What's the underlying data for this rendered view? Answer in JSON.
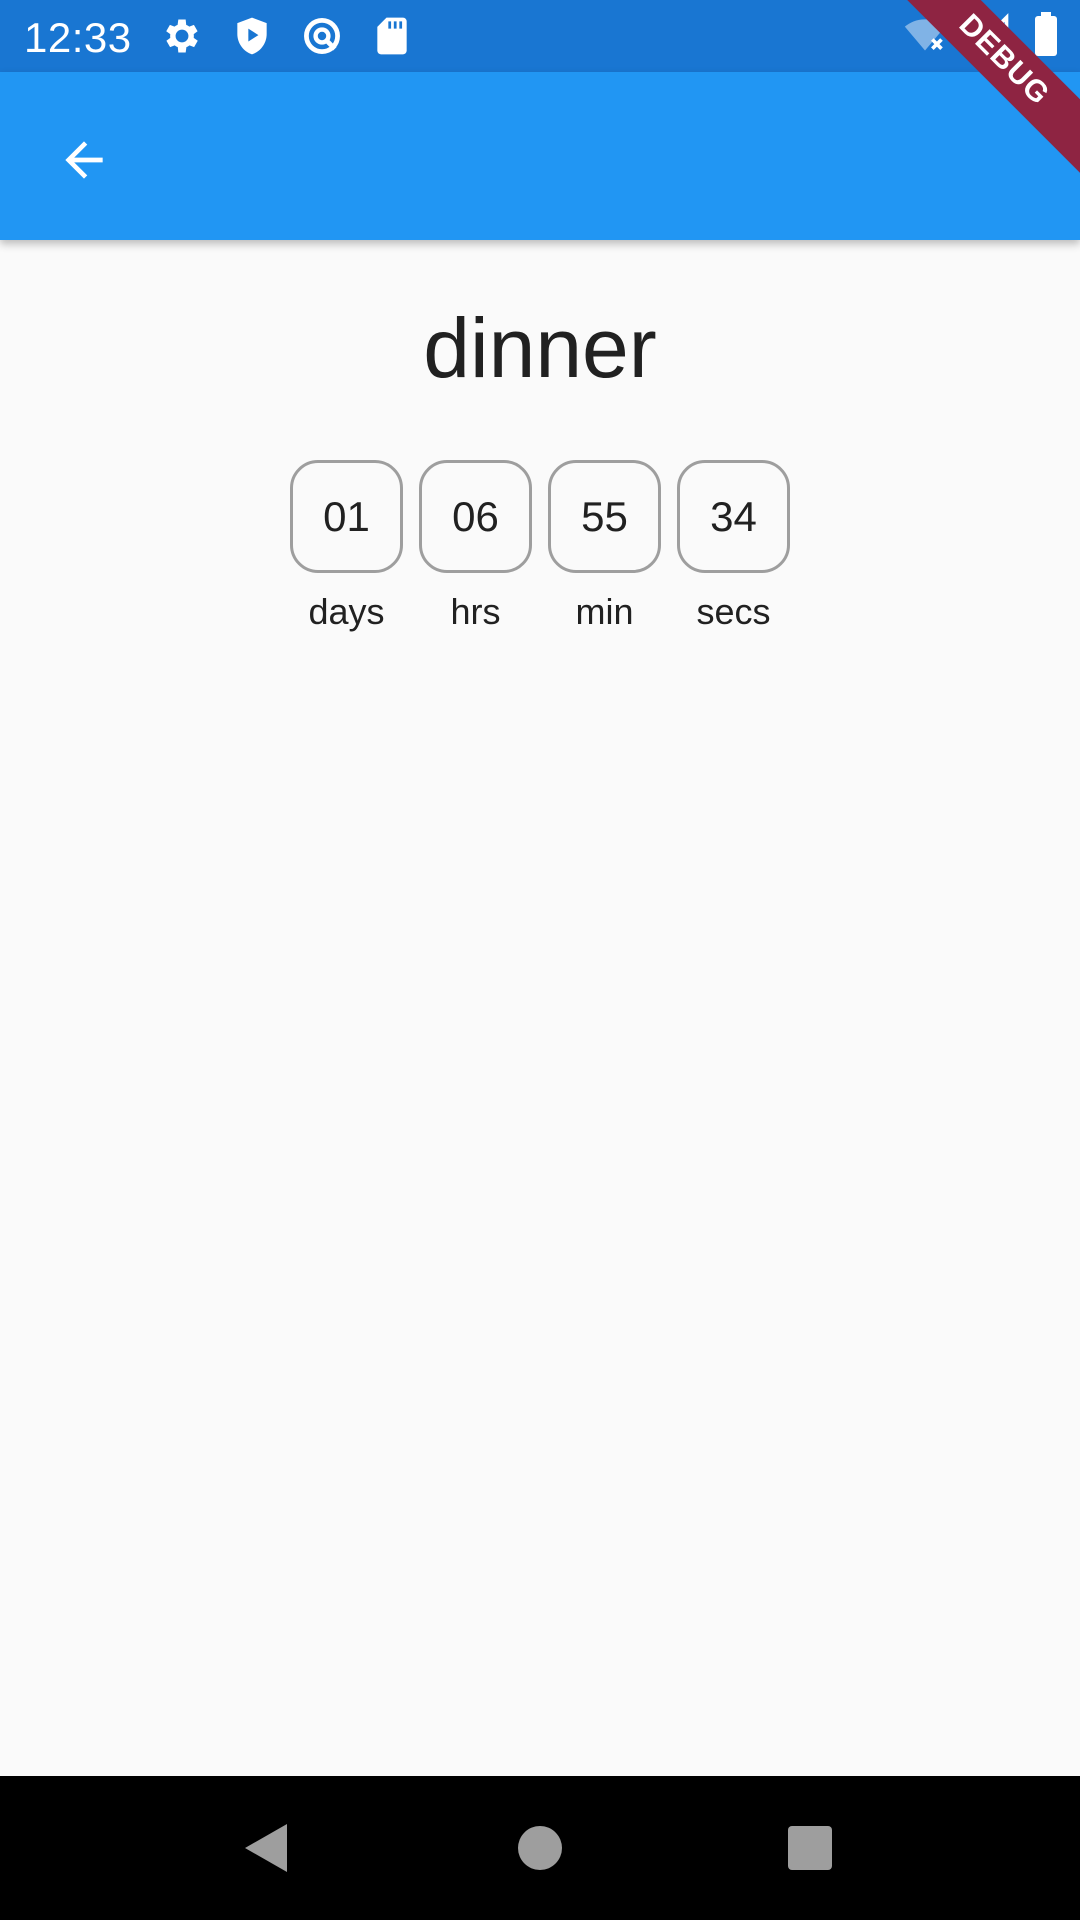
{
  "status_bar": {
    "time": "12:33",
    "left_icons": [
      "settings-icon",
      "shield-play-icon",
      "vpn-icon",
      "sd-card-icon"
    ],
    "right_icons": [
      "wifi-off-icon",
      "signal-icon",
      "battery-icon"
    ]
  },
  "debug_banner": {
    "label": "DEBUG"
  },
  "app_bar": {
    "back_icon": "arrow-back-icon",
    "color": "#2196F3"
  },
  "event": {
    "title": "dinner"
  },
  "countdown": {
    "days": {
      "value": "01",
      "label": "days"
    },
    "hours": {
      "value": "06",
      "label": "hrs"
    },
    "minutes": {
      "value": "55",
      "label": "min"
    },
    "seconds": {
      "value": "34",
      "label": "secs"
    }
  },
  "nav_bar": {
    "icons": [
      "back-triangle-icon",
      "home-circle-icon",
      "recents-square-icon"
    ]
  }
}
